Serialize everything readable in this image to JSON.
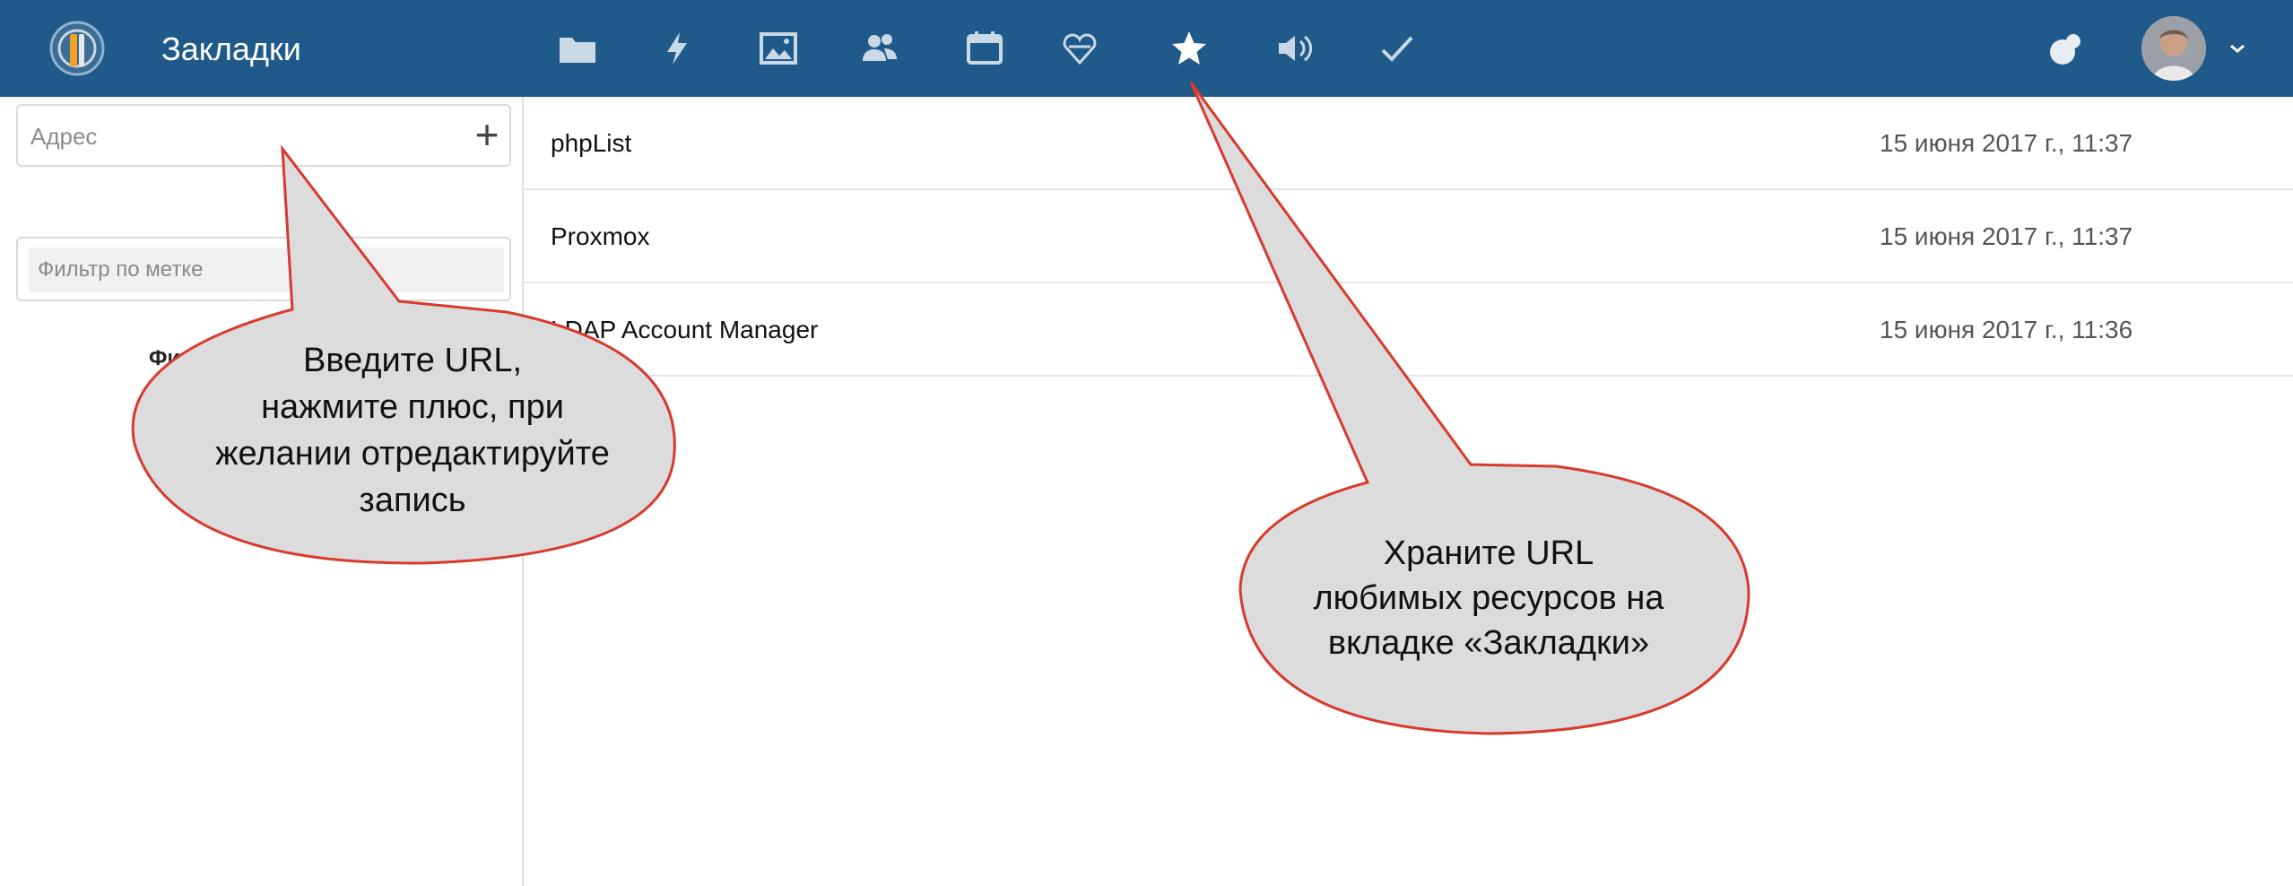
{
  "app": {
    "title": "Закладки"
  },
  "nav": [
    {
      "icon": "folder-icon"
    },
    {
      "icon": "lightning-icon"
    },
    {
      "icon": "image-icon"
    },
    {
      "icon": "contacts-icon"
    },
    {
      "icon": "calendar-icon"
    },
    {
      "icon": "heart-icon"
    },
    {
      "icon": "star-icon",
      "active": true
    },
    {
      "icon": "speaker-icon"
    },
    {
      "icon": "check-icon"
    }
  ],
  "sidebar": {
    "address_placeholder": "Адрес",
    "add_label": "+",
    "filter_placeholder": "Фильтр по метке",
    "partial_label": "Фи"
  },
  "bookmarks": [
    {
      "title": "phpList",
      "date": "15 июня 2017 г., 11:37"
    },
    {
      "title": "Proxmox",
      "date": "15 июня 2017 г., 11:37"
    },
    {
      "title": "LDAP Account Manager",
      "date": "15 июня 2017 г., 11:36"
    }
  ],
  "callouts": {
    "left_lines": [
      "Введите URL,",
      "нажмите плюс, при",
      "желании отредактируйте",
      "запись"
    ],
    "right_lines": [
      "Храните URL",
      "любимых ресурсов на",
      "вкладке «Закладки»"
    ]
  },
  "colors": {
    "topbar": "#1f5a8a",
    "callout_fill": "#dcdcdc",
    "callout_stroke": "#d83a2e"
  }
}
